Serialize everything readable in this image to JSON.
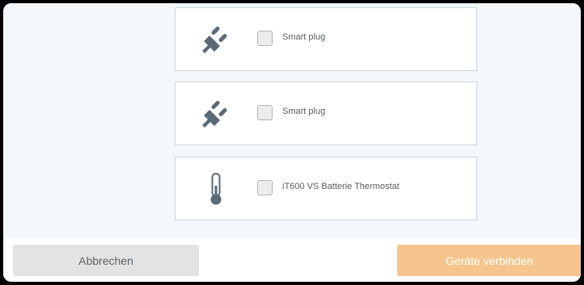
{
  "colors": {
    "accent": "#f6c58d",
    "icon": "#5a6a77",
    "content_bg": "#f4f8fc",
    "card_border": "#c9d3dc"
  },
  "devices": [
    {
      "icon": "plug-icon",
      "label": "Smart plug",
      "checked": false
    },
    {
      "icon": "plug-icon",
      "label": "Smart plug",
      "checked": false
    },
    {
      "icon": "thermometer-icon",
      "label": "iT600 VS Batterie Thermostat",
      "checked": false
    }
  ],
  "footer": {
    "cancel_label": "Abbrechen",
    "connect_label": "Geräte verbinden"
  }
}
